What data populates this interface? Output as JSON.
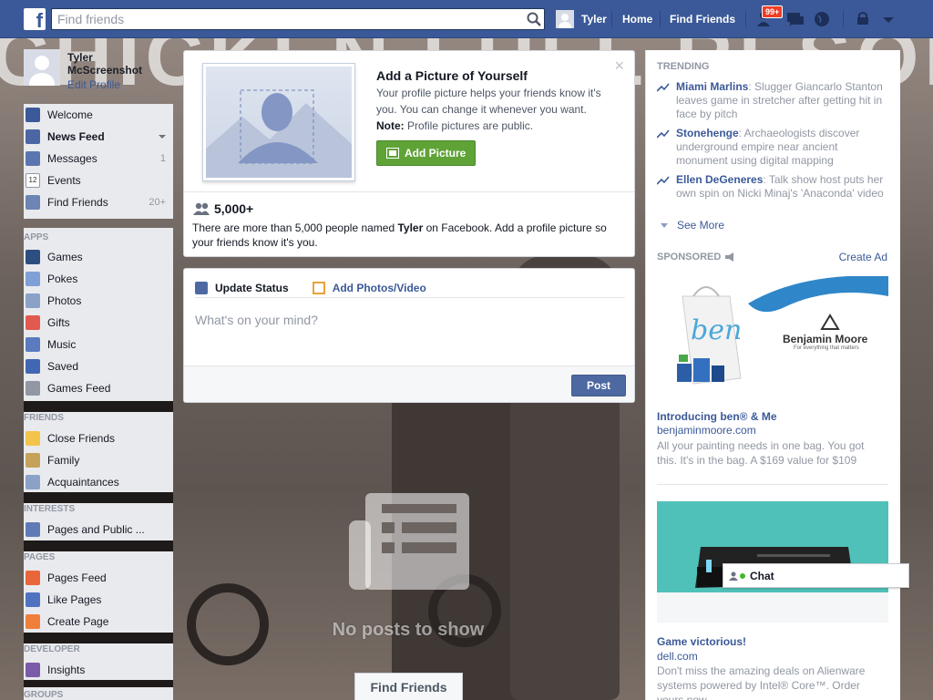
{
  "topbar": {
    "logo": "f",
    "search_placeholder": "Find friends",
    "user_name": "Tyler",
    "home": "Home",
    "find_friends": "Find Friends",
    "notification_badge": "99+"
  },
  "left": {
    "profile_name": "Tyler McScreenshot",
    "edit_profile": "Edit Profile",
    "main_items": [
      {
        "label": "Welcome",
        "icon": "facebook-icon",
        "count": ""
      },
      {
        "label": "News Feed",
        "icon": "news-feed-icon",
        "count": ""
      },
      {
        "label": "Messages",
        "icon": "messages-icon",
        "count": "1"
      },
      {
        "label": "Events",
        "icon": "calendar-icon",
        "count": ""
      },
      {
        "label": "Find Friends",
        "icon": "find-friends-icon",
        "count": "20+"
      }
    ],
    "apps_header": "APPS",
    "apps": [
      {
        "label": "Games"
      },
      {
        "label": "Pokes"
      },
      {
        "label": "Photos"
      },
      {
        "label": "Gifts"
      },
      {
        "label": "Music"
      },
      {
        "label": "Saved"
      },
      {
        "label": "Games Feed"
      }
    ],
    "friends_header": "FRIENDS",
    "friends": [
      {
        "label": "Close Friends"
      },
      {
        "label": "Family"
      },
      {
        "label": "Acquaintances"
      }
    ],
    "interests_header": "INTERESTS",
    "interests": [
      {
        "label": "Pages and Public ..."
      }
    ],
    "pages_header": "PAGES",
    "pages": [
      {
        "label": "Pages Feed"
      },
      {
        "label": "Like Pages"
      },
      {
        "label": "Create Page"
      }
    ],
    "developer_header": "DEVELOPER",
    "developer": [
      {
        "label": "Insights"
      }
    ],
    "groups_header": "GROUPS"
  },
  "picture_prompt": {
    "title": "Add a Picture of Yourself",
    "body": "Your profile picture helps your friends know it's you. You can change it whenever you want.",
    "note_label": "Note:",
    "note_text": " Profile pictures are public.",
    "button": "Add Picture",
    "close": "×",
    "count": "5,000+",
    "count_desc_1": "There are more than 5,000 people named ",
    "count_desc_name": "Tyler",
    "count_desc_2": " on Facebook. Add a profile picture so your friends know it's you."
  },
  "composer": {
    "tab_status": "Update Status",
    "tab_photos": "Add Photos/Video",
    "placeholder": "What's on your mind?",
    "post": "Post"
  },
  "feed": {
    "empty": "No posts to show",
    "find_friends": "Find Friends"
  },
  "trending": {
    "header": "TRENDING",
    "items": [
      {
        "name": "Miami Marlins",
        "text": ": Slugger Giancarlo Stanton leaves game in stretcher after getting hit in face by pitch"
      },
      {
        "name": "Stonehenge",
        "text": ": Archaeologists discover underground empire near ancient monument using digital mapping"
      },
      {
        "name": "Ellen DeGeneres",
        "text": ": Talk show host puts her own spin on Nicki Minaj's 'Anaconda' video"
      }
    ],
    "see_more": "See More"
  },
  "sponsored": {
    "header": "SPONSORED",
    "create_ad": "Create Ad",
    "ads": [
      {
        "title": "Introducing ben® & Me",
        "domain": "benjaminmoore.com",
        "desc": "All your painting needs in one bag. You got this. It's in the bag. A $169 value for $109",
        "brand": "Benjamin Moore",
        "tagline": "For everything that matters",
        "bag_text": "ben"
      },
      {
        "title": "Game victorious!",
        "domain": "dell.com",
        "desc": "Don't miss the amazing deals on Alienware systems powered by Intel® Core™. Order yours now."
      }
    ]
  },
  "chat": {
    "label": "Chat"
  },
  "colors": {
    "brand": "#3b5998",
    "green": "#5fa337",
    "badge": "#f03d25"
  }
}
